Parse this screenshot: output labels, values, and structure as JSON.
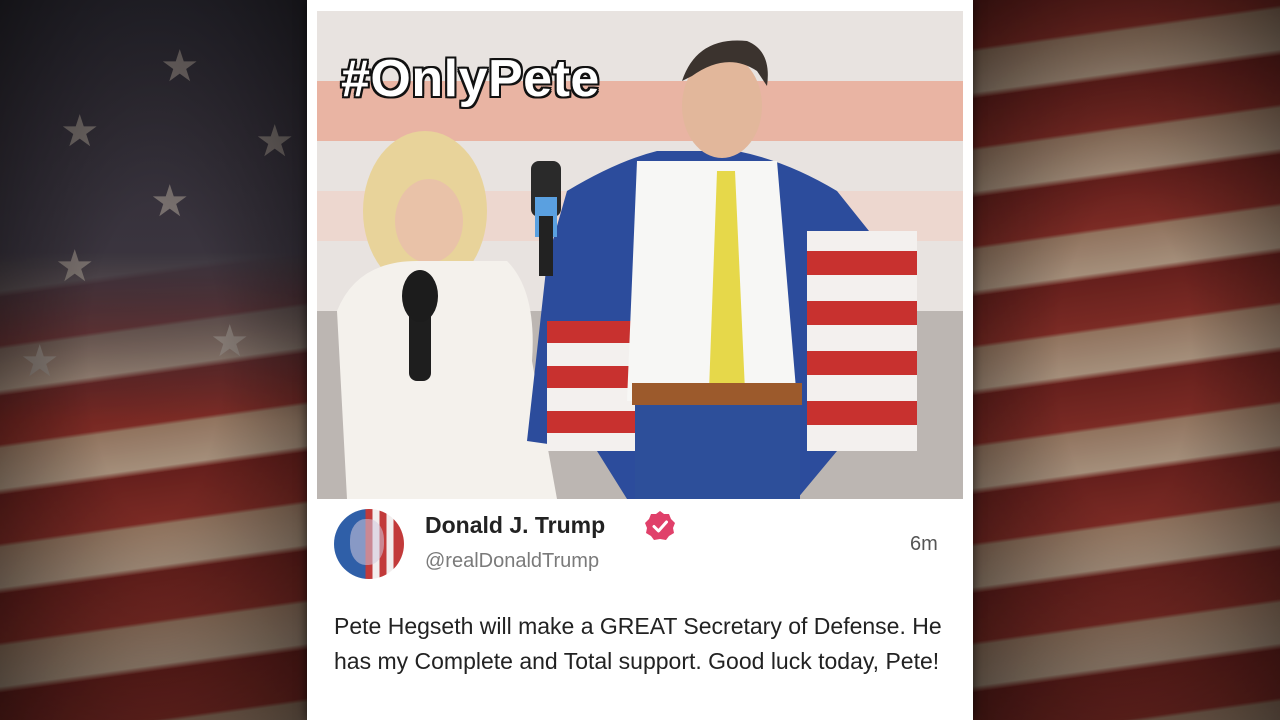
{
  "post": {
    "image_overlay_text": "#OnlyPete",
    "author_name": "Donald J. Trump",
    "author_handle": "@realDonaldTrump",
    "timestamp": "6m",
    "text": "Pete Hegseth will make a GREAT Secretary of Defense. He has my Complete and Total support. Good luck today, Pete!"
  },
  "colors": {
    "verified_badge": "#e0406a",
    "card_background": "#ffffff",
    "flag_red": "#a5312a",
    "flag_blue": "#2f4f8f"
  },
  "icons": {
    "verified": "verified-check-badge-icon",
    "background_stars": "star-icon"
  }
}
